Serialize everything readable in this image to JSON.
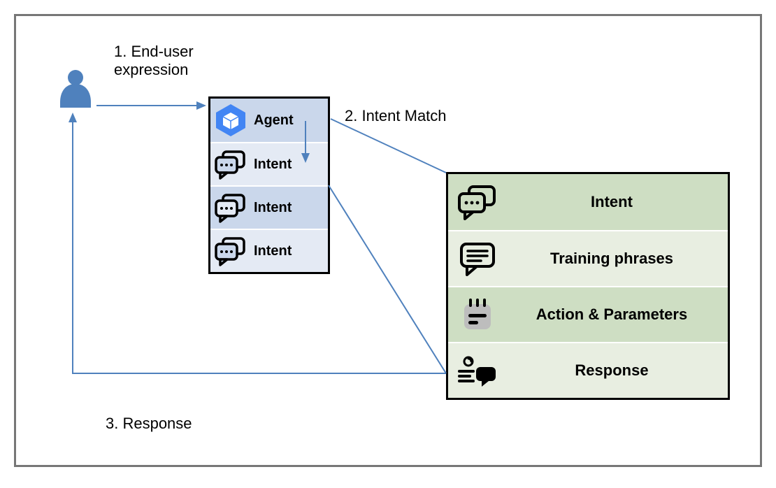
{
  "labels": {
    "step1": "1. End-user\nexpression",
    "step2": "2. Intent Match",
    "step3": "3. Response"
  },
  "agent_box": {
    "rows": [
      {
        "label": "Agent"
      },
      {
        "label": "Intent"
      },
      {
        "label": "Intent"
      },
      {
        "label": "Intent"
      }
    ]
  },
  "detail_box": {
    "rows": [
      {
        "label": "Intent"
      },
      {
        "label": "Training phrases"
      },
      {
        "label": "Action & Parameters"
      },
      {
        "label": "Response"
      }
    ]
  }
}
